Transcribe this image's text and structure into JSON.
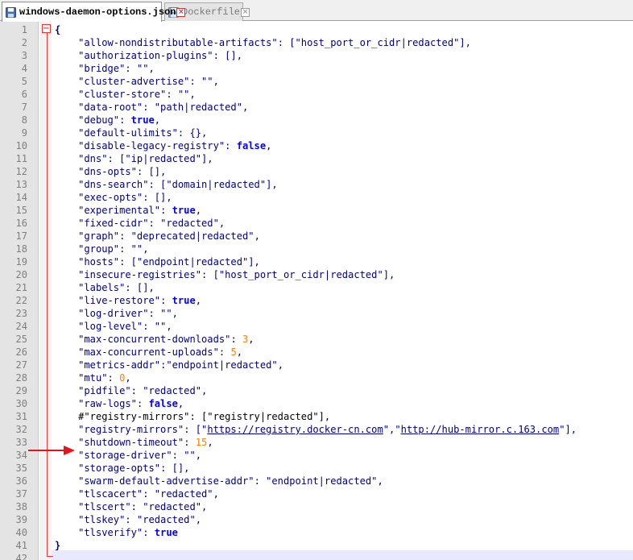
{
  "tabs": [
    {
      "label": "windows-daemon-options.json",
      "active": true
    },
    {
      "label": "Dockerfile",
      "active": false
    }
  ],
  "colors": {
    "fold_marker": "#e03b3b",
    "arrow": "#e8121a",
    "keyword": "#0000ff",
    "number": "#ff8000",
    "string": "#000080"
  },
  "icons": {
    "tab_file": "save-disk-icon",
    "tab_close": "close-icon",
    "fold": "fold-minus-icon",
    "annotation": "red-arrow"
  },
  "lines": [
    [
      [
        "b",
        "{"
      ]
    ],
    [
      [
        "s",
        "\"allow-nondistributable-artifacts\""
      ],
      [
        "p",
        ": ["
      ],
      [
        "s",
        "\"host_port_or_cidr|redacted\""
      ],
      [
        "p",
        "],"
      ]
    ],
    [
      [
        "s",
        "\"authorization-plugins\""
      ],
      [
        "p",
        ": [],"
      ]
    ],
    [
      [
        "s",
        "\"bridge\""
      ],
      [
        "p",
        ": "
      ],
      [
        "s",
        "\"\""
      ],
      [
        "p",
        ","
      ]
    ],
    [
      [
        "s",
        "\"cluster-advertise\""
      ],
      [
        "p",
        ": "
      ],
      [
        "s",
        "\"\""
      ],
      [
        "p",
        ","
      ]
    ],
    [
      [
        "s",
        "\"cluster-store\""
      ],
      [
        "p",
        ": "
      ],
      [
        "s",
        "\"\""
      ],
      [
        "p",
        ","
      ]
    ],
    [
      [
        "s",
        "\"data-root\""
      ],
      [
        "p",
        ": "
      ],
      [
        "s",
        "\"path|redacted\""
      ],
      [
        "p",
        ","
      ]
    ],
    [
      [
        "s",
        "\"debug\""
      ],
      [
        "p",
        ": "
      ],
      [
        "k",
        "true"
      ],
      [
        "p",
        ","
      ]
    ],
    [
      [
        "s",
        "\"default-ulimits\""
      ],
      [
        "p",
        ": {},"
      ]
    ],
    [
      [
        "s",
        "\"disable-legacy-registry\""
      ],
      [
        "p",
        ": "
      ],
      [
        "k",
        "false"
      ],
      [
        "p",
        ","
      ]
    ],
    [
      [
        "s",
        "\"dns\""
      ],
      [
        "p",
        ": ["
      ],
      [
        "s",
        "\"ip|redacted\""
      ],
      [
        "p",
        "],"
      ]
    ],
    [
      [
        "s",
        "\"dns-opts\""
      ],
      [
        "p",
        ": [],"
      ]
    ],
    [
      [
        "s",
        "\"dns-search\""
      ],
      [
        "p",
        ": ["
      ],
      [
        "s",
        "\"domain|redacted\""
      ],
      [
        "p",
        "],"
      ]
    ],
    [
      [
        "s",
        "\"exec-opts\""
      ],
      [
        "p",
        ": [],"
      ]
    ],
    [
      [
        "s",
        "\"experimental\""
      ],
      [
        "p",
        ": "
      ],
      [
        "k",
        "true"
      ],
      [
        "p",
        ","
      ]
    ],
    [
      [
        "s",
        "\"fixed-cidr\""
      ],
      [
        "p",
        ": "
      ],
      [
        "s",
        "\"redacted\""
      ],
      [
        "p",
        ","
      ]
    ],
    [
      [
        "s",
        "\"graph\""
      ],
      [
        "p",
        ": "
      ],
      [
        "s",
        "\"deprecated|redacted\""
      ],
      [
        "p",
        ","
      ]
    ],
    [
      [
        "s",
        "\"group\""
      ],
      [
        "p",
        ": "
      ],
      [
        "s",
        "\"\""
      ],
      [
        "p",
        ","
      ]
    ],
    [
      [
        "s",
        "\"hosts\""
      ],
      [
        "p",
        ": ["
      ],
      [
        "s",
        "\"endpoint|redacted\""
      ],
      [
        "p",
        "],"
      ]
    ],
    [
      [
        "s",
        "\"insecure-registries\""
      ],
      [
        "p",
        ": ["
      ],
      [
        "s",
        "\"host_port_or_cidr|redacted\""
      ],
      [
        "p",
        "],"
      ]
    ],
    [
      [
        "s",
        "\"labels\""
      ],
      [
        "p",
        ": [],"
      ]
    ],
    [
      [
        "s",
        "\"live-restore\""
      ],
      [
        "p",
        ": "
      ],
      [
        "k",
        "true"
      ],
      [
        "p",
        ","
      ]
    ],
    [
      [
        "s",
        "\"log-driver\""
      ],
      [
        "p",
        ": "
      ],
      [
        "s",
        "\"\""
      ],
      [
        "p",
        ","
      ]
    ],
    [
      [
        "s",
        "\"log-level\""
      ],
      [
        "p",
        ": "
      ],
      [
        "s",
        "\"\""
      ],
      [
        "p",
        ","
      ]
    ],
    [
      [
        "s",
        "\"max-concurrent-downloads\""
      ],
      [
        "p",
        ": "
      ],
      [
        "n",
        "3"
      ],
      [
        "p",
        ","
      ]
    ],
    [
      [
        "s",
        "\"max-concurrent-uploads\""
      ],
      [
        "p",
        ": "
      ],
      [
        "n",
        "5"
      ],
      [
        "p",
        ","
      ]
    ],
    [
      [
        "s",
        "\"metrics-addr\""
      ],
      [
        "p",
        ":"
      ],
      [
        "s",
        "\"endpoint|redacted\""
      ],
      [
        "p",
        ","
      ]
    ],
    [
      [
        "s",
        "\"mtu\""
      ],
      [
        "p",
        ": "
      ],
      [
        "n",
        "0"
      ],
      [
        "p",
        ","
      ]
    ],
    [
      [
        "s",
        "\"pidfile\""
      ],
      [
        "p",
        ": "
      ],
      [
        "s",
        "\"redacted\""
      ],
      [
        "p",
        ","
      ]
    ],
    [
      [
        "s",
        "\"raw-logs\""
      ],
      [
        "p",
        ": "
      ],
      [
        "k",
        "false"
      ],
      [
        "p",
        ","
      ]
    ],
    [
      [
        "c",
        "#\"registry-mirrors\": [\"registry|redacted\"],"
      ]
    ],
    [
      [
        "s",
        "\"registry-mirrors\""
      ],
      [
        "p",
        ": ["
      ],
      [
        "s",
        "\""
      ],
      [
        "u",
        "https://registry.docker-cn.com"
      ],
      [
        "s",
        "\""
      ],
      [
        "p",
        ","
      ],
      [
        "s",
        "\""
      ],
      [
        "u",
        "http://hub-mirror.c.163.com"
      ],
      [
        "s",
        "\""
      ],
      [
        "p",
        "],"
      ]
    ],
    [
      [
        "s",
        "\"shutdown-timeout\""
      ],
      [
        "p",
        ": "
      ],
      [
        "n",
        "15"
      ],
      [
        "p",
        ","
      ]
    ],
    [
      [
        "s",
        "\"storage-driver\""
      ],
      [
        "p",
        ": "
      ],
      [
        "s",
        "\"\""
      ],
      [
        "p",
        ","
      ]
    ],
    [
      [
        "s",
        "\"storage-opts\""
      ],
      [
        "p",
        ": [],"
      ]
    ],
    [
      [
        "s",
        "\"swarm-default-advertise-addr\""
      ],
      [
        "p",
        ": "
      ],
      [
        "s",
        "\"endpoint|redacted\""
      ],
      [
        "p",
        ","
      ]
    ],
    [
      [
        "s",
        "\"tlscacert\""
      ],
      [
        "p",
        ": "
      ],
      [
        "s",
        "\"redacted\""
      ],
      [
        "p",
        ","
      ]
    ],
    [
      [
        "s",
        "\"tlscert\""
      ],
      [
        "p",
        ": "
      ],
      [
        "s",
        "\"redacted\""
      ],
      [
        "p",
        ","
      ]
    ],
    [
      [
        "s",
        "\"tlskey\""
      ],
      [
        "p",
        ": "
      ],
      [
        "s",
        "\"redacted\""
      ],
      [
        "p",
        ","
      ]
    ],
    [
      [
        "s",
        "\"tlsverify\""
      ],
      [
        "p",
        ": "
      ],
      [
        "k",
        "true"
      ]
    ],
    [
      [
        "b",
        "}"
      ]
    ],
    []
  ]
}
